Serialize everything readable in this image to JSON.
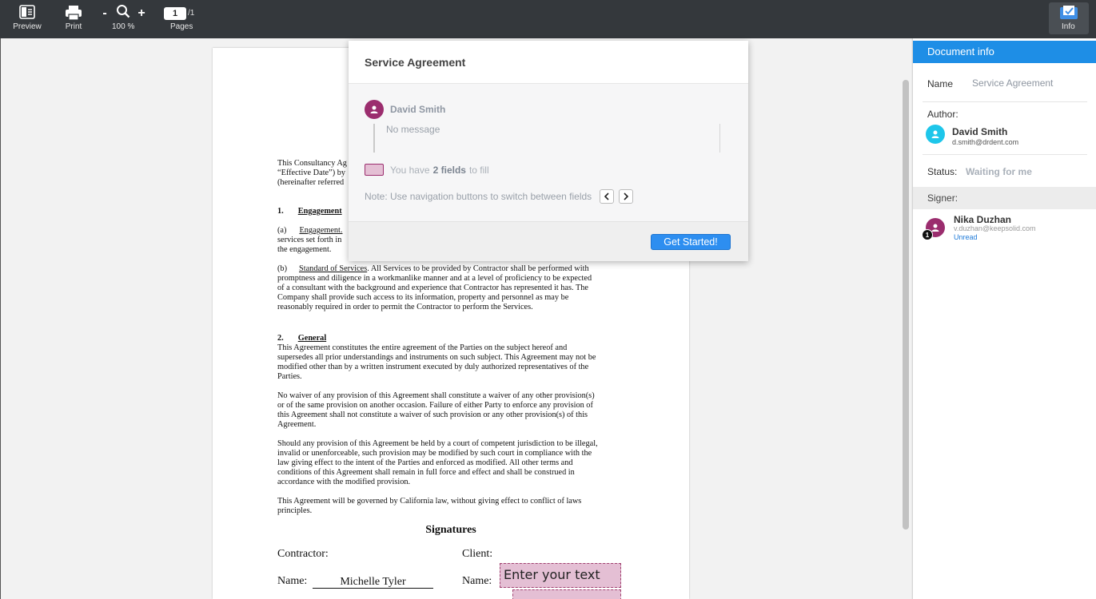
{
  "toolbar": {
    "preview_label": "Preview",
    "print_label": "Print",
    "zoom_minus": "-",
    "zoom_plus": "+",
    "zoom_value": "100 %",
    "page_current": "1",
    "page_total": "/1",
    "pages_label": "Pages",
    "info_label": "Info"
  },
  "document": {
    "intro": [
      "This Consultancy Ag",
      "“Effective Date”) by",
      "(hereinafter referred"
    ],
    "s1_num": "1.",
    "s1_title": "Engagement",
    "s1a_label": "(a)",
    "s1a_title": "Engagement.",
    "s1a_lines": [
      "services set forth in",
      "the engagement."
    ],
    "s1b_label": "(b)",
    "s1b_title": "Standard of Services",
    "s1b_first": ". All Services to be provided by Contractor shall be performed with",
    "s1b_lines": [
      "promptness and diligence in a workmanlike manner and at a level of proficiency to be expected",
      "of a consultant with the background and experience that Contractor has represented it has. The",
      "Company shall provide such access to its information, property and personnel as may be",
      "reasonably required in order to permit the Contractor to perform the Services."
    ],
    "s2_num": "2.",
    "s2_title": "General",
    "s2_p1": [
      "This Agreement constitutes the entire agreement of the Parties on the subject hereof and",
      "supersedes all prior understandings and instruments on such subject. This Agreement may not be",
      "modified other than by a written instrument executed by duly authorized representatives of the",
      "Parties."
    ],
    "s2_p2": [
      "No waiver of any provision of this Agreement shall constitute a waiver of any other provision(s)",
      "or of the same provision on another occasion. Failure of either Party to enforce any provision of",
      "this Agreement shall not constitute a waiver of such provision or any other provision(s) of this",
      "Agreement."
    ],
    "s2_p3": [
      "Should any provision of this Agreement be held by a court of competent jurisdiction to be illegal,",
      "invalid or unenforceable, such provision may be modified by such court in compliance with the",
      "law giving effect to the intent of the Parties and enforced as modified. All other terms and",
      "conditions of this Agreement shall remain in full force and effect and shall be construed in",
      "accordance with the modified provision."
    ],
    "s2_p4": [
      "This Agreement will be governed by California law, without giving effect to conflict of laws",
      "principles."
    ],
    "signatures_title": "Signatures",
    "contractor_label": "Contractor:",
    "client_label": "Client:",
    "name_label": "Name:",
    "contractor_name": "Michelle Tyler",
    "client_name_label": "Name:",
    "field_placeholder": "Enter your text"
  },
  "popup": {
    "title": "Service Agreement",
    "sender_name": "David Smith",
    "message": "No message",
    "fields_prefix": "You have",
    "fields_count": "2 fields",
    "fields_suffix": "to fill",
    "note": "Note: Use navigation buttons to switch between fields",
    "prev_icon": "chevron-left-icon",
    "next_icon": "chevron-right-icon",
    "start_button": "Get Started!"
  },
  "info_panel": {
    "header": "Document info",
    "name_label": "Name",
    "name_value": "Service Agreement",
    "author_label": "Author:",
    "author_name": "David Smith",
    "author_email": "d.smith@drdent.com",
    "status_label": "Status:",
    "status_value": "Waiting for me",
    "signer_label": "Signer:",
    "signer_name": "Nika Duzhan",
    "signer_email": "v.duzhan@keepsolid.com",
    "signer_status": "Unread",
    "signer_badge": "1"
  },
  "colors": {
    "toolbar": "#34383c",
    "accent_blue": "#1e8ee6",
    "field_pink": "#e4bfd4",
    "avatar_purple": "#9b2d6e",
    "avatar_cyan": "#1ec6ea"
  }
}
